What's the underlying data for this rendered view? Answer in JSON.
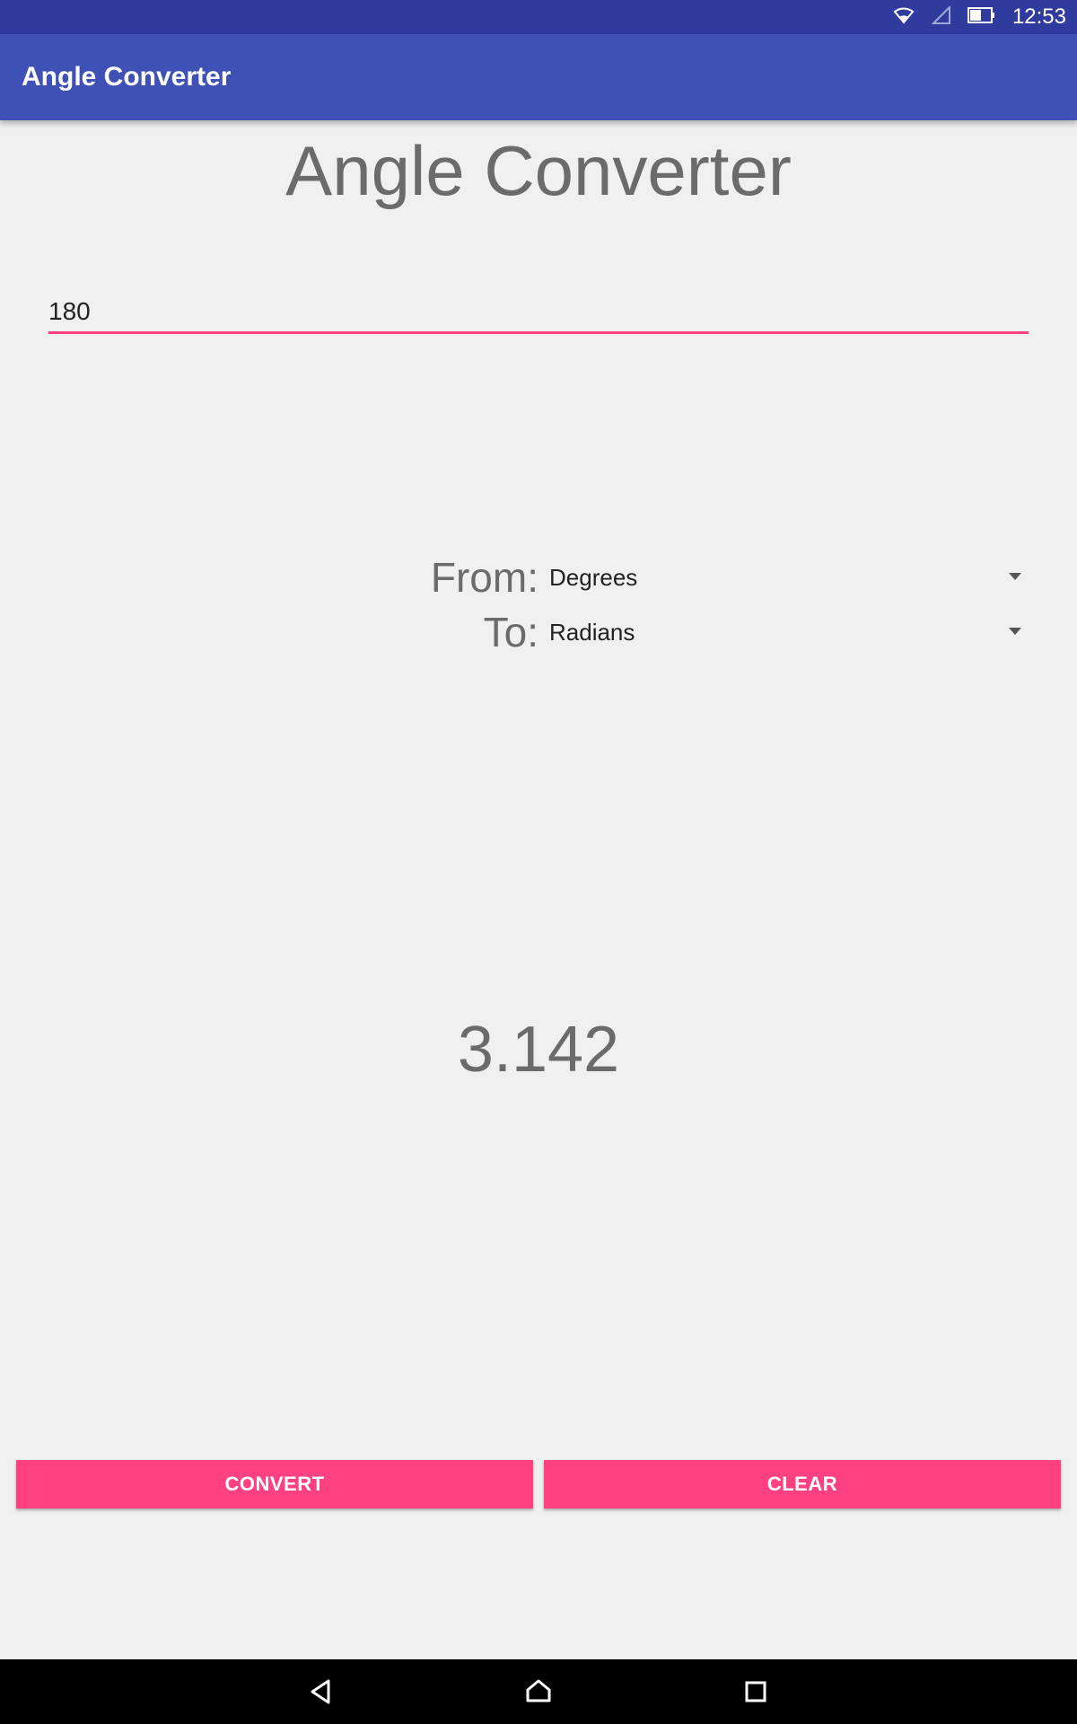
{
  "status_bar": {
    "time": "12:53",
    "icons": [
      "wifi-icon",
      "signal-icon",
      "battery-icon"
    ]
  },
  "app_bar": {
    "title": "Angle Converter",
    "color": "#3f51b5",
    "status_color": "#2f3c9e"
  },
  "main": {
    "heading": "Angle Converter",
    "input": {
      "value": "180",
      "placeholder": ""
    },
    "from": {
      "label": "From:",
      "selected": "Degrees"
    },
    "to": {
      "label": "To:",
      "selected": "Radians"
    },
    "result": "3.142"
  },
  "buttons": {
    "convert_label": "CONVERT",
    "clear_label": "CLEAR",
    "accent": "#ff4081"
  },
  "nav_bar": {
    "icons": [
      "back-icon",
      "home-icon",
      "recents-icon"
    ]
  }
}
